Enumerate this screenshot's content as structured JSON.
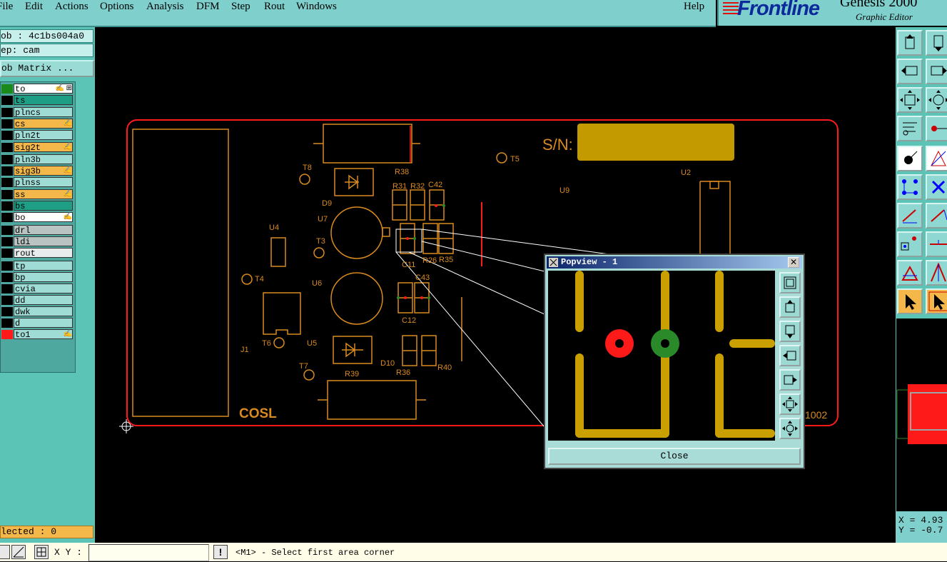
{
  "menu": {
    "items": [
      "File",
      "Edit",
      "Actions",
      "Options",
      "Analysis",
      "DFM",
      "Step",
      "Rout",
      "Windows",
      "Help"
    ]
  },
  "brand": {
    "logo": "Frontline",
    "product": "Genesis 2000",
    "subtitle": "Graphic Editor"
  },
  "job": {
    "label": "ob : 4c1bs004a0",
    "step": "ep: cam",
    "matrix_button": "ob Matrix ..."
  },
  "layers": [
    {
      "name": "to",
      "swatch": "#1a8a1a",
      "bg": "#ffffff",
      "mark": "✍ ⊞"
    },
    {
      "name": "ts",
      "swatch": "#000000",
      "bg": "#1f9e86",
      "mark": ""
    },
    {
      "name": "plncs",
      "swatch": "#000000",
      "bg": "#9fdcd6",
      "mark": ""
    },
    {
      "name": "cs",
      "swatch": "#000000",
      "bg": "#f4b74a",
      "mark": "✍"
    },
    {
      "name": "pln2t",
      "swatch": "#000000",
      "bg": "#9fdcd6",
      "mark": ""
    },
    {
      "name": "sig2t",
      "swatch": "#000000",
      "bg": "#f4b74a",
      "mark": "✍"
    },
    {
      "name": "pln3b",
      "swatch": "#000000",
      "bg": "#9fdcd6",
      "mark": ""
    },
    {
      "name": "sig3b",
      "swatch": "#000000",
      "bg": "#f4b74a",
      "mark": "✍"
    },
    {
      "name": "plnss",
      "swatch": "#000000",
      "bg": "#9fdcd6",
      "mark": ""
    },
    {
      "name": "ss",
      "swatch": "#000000",
      "bg": "#f4b74a",
      "mark": "✍"
    },
    {
      "name": "bs",
      "swatch": "#000000",
      "bg": "#1f9e86",
      "mark": ""
    },
    {
      "name": "bo",
      "swatch": "#000000",
      "bg": "#ffffff",
      "mark": "✍"
    },
    {
      "name": "drl",
      "swatch": "#000000",
      "bg": "#b9c3c2",
      "mark": ""
    },
    {
      "name": "ldi",
      "swatch": "#000000",
      "bg": "#b9c3c2",
      "mark": ""
    },
    {
      "name": "rout",
      "swatch": "#000000",
      "bg": "#e8ecec",
      "mark": ""
    },
    {
      "name": "tp",
      "swatch": "#000000",
      "bg": "#9fdcd6",
      "mark": ""
    },
    {
      "name": "bp",
      "swatch": "#000000",
      "bg": "#9fdcd6",
      "mark": ""
    },
    {
      "name": "cvia",
      "swatch": "#000000",
      "bg": "#9fdcd6",
      "mark": ""
    },
    {
      "name": "dd",
      "swatch": "#000000",
      "bg": "#9fdcd6",
      "mark": ""
    },
    {
      "name": "dwk",
      "swatch": "#000000",
      "bg": "#9fdcd6",
      "mark": ""
    },
    {
      "name": "d",
      "swatch": "#000000",
      "bg": "#9fdcd6",
      "mark": ""
    },
    {
      "name": "to1",
      "swatch": "#ff1a1a",
      "bg": "#9fdcd6",
      "mark": "✍"
    }
  ],
  "selected": "lected : 0",
  "board": {
    "sn_label": "S/N:",
    "brand_text": "COSL",
    "code_text": "1002",
    "refdes": [
      "T8",
      "D9",
      "R38",
      "R31",
      "R32",
      "C42",
      "T5",
      "U2",
      "U9",
      "U4",
      "U7",
      "T3",
      "T4",
      "U6",
      "R26",
      "R35",
      "C11",
      "C43",
      "C12",
      "J1",
      "T6",
      "U5",
      "T7",
      "D10",
      "R36",
      "R40",
      "R39"
    ]
  },
  "popview": {
    "title": "Popview - 1",
    "close_label": "Close",
    "close_x": "✕"
  },
  "coords": {
    "x": "X = 4.93",
    "y": "Y = -0.7"
  },
  "status": {
    "xy_label": "X Y :",
    "xy_value": "",
    "prompt": "<M1> - Select first area corner",
    "excl": "!"
  },
  "colors": {
    "outline": "#ff1a1a",
    "silk": "#d98a1f",
    "copper": "#c9a000",
    "pad_red": "#ff1a1a",
    "pad_green": "#2a8a2a",
    "panel": "#5cc4b6"
  }
}
